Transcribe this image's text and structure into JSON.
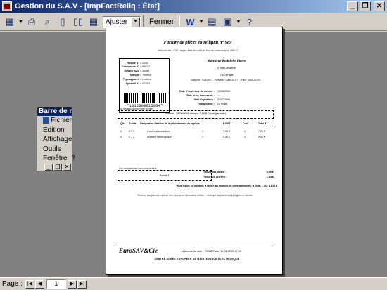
{
  "window": {
    "title": "Gestion du S.A.V - [ImpFactReliq : État]"
  },
  "toolbar": {
    "zoom_value": "Ajuster",
    "close_label": "Fermer"
  },
  "report": {
    "title": "Facture de pièces en reliquat n° 989",
    "subtitle": "Reliquat de la CDE, réglée dans le cadre du bon de commande n° 968/17",
    "info": [
      {
        "k": "Facture N° :",
        "v": "1035"
      },
      {
        "k": "Commande N° :",
        "v": "968/17"
      },
      {
        "k": "Dossier SAV :",
        "v": "36464"
      },
      {
        "k": "Marque :",
        "v": "Thomso"
      },
      {
        "k": "Type appareil :",
        "v": "Lecteur"
      },
      {
        "k": "Appareil N° :",
        "v": "0743/4"
      }
    ],
    "barcode_number": "*1612308025034*",
    "client": {
      "name": "Monsieur Rodolphe Pierre",
      "line1": "4 Rue Lamartine",
      "line2": "75001   Paris",
      "line3": "Domicile : 0142 00 ...     Portable : 0606 12 87 ...     Fax : 0145 23 99 ..."
    },
    "dates": [
      {
        "k": "Date d'ouverture du dossier :",
        "v": "15/05/2006"
      },
      {
        "k": "Date prise commande :",
        "v": "...."
      },
      {
        "k": "Date Expédition :",
        "v": "07/07/2006"
      },
      {
        "k": "Transporteur :",
        "v": "La Poste"
      }
    ],
    "caption_top": "Vos remarques pour notre service :",
    "remark": "Acheté : 28/09/2006 chèque 7,50 € (Vu le garantie)",
    "columns": [
      "Qté",
      "Article",
      "Désignation détaillée de la pièce dentaire de la pièce",
      "P.U.HT",
      "Code",
      "Total HT"
    ],
    "rows": [
      {
        "chk": "X",
        "qte": "2 / 1",
        "article": "2 7 1",
        "designation": "Cordon alimentation",
        "qty": "1",
        "pu": "7,00 €",
        "code": "1",
        "total": "7,00 €"
      },
      {
        "chk": "X",
        "qte": "2 / 1",
        "article": "2 7 2",
        "designation": "Antenne télescopique",
        "qty": "1",
        "pu": "2,40 €",
        "code": "1",
        "total": "2,40 €"
      }
    ],
    "caption_bottom": "Vos commentaires pour notre facture :",
    "comment": "Article 1",
    "totals": [
      {
        "k": "Total Hors taxes :",
        "v": "9,40 €"
      },
      {
        "k": "Total TVA (19,6%) :",
        "v": "1,84 €"
      },
      {
        "k": "Total T.T.C :",
        "v": "11,24 €"
      }
    ],
    "pay_line": "( Vous réglez ce montant, à régler, au moment de votre paiement ) ➜ Total T.T.C :",
    "note": "*Retenue des pièces en attente d'un mois avant l'annulation d'office ... ainsi que les sommes déjà réglées en attente.",
    "logo": "EuroSAV&Cie",
    "address": "4 Avenue du mail ... 75008 Paris     Tél. 01 23 45 67 89",
    "tagline": "CENTRE AGRÉÉ EUROPÉEN DE MAINTENANCE ÉLECTRONIQUE"
  },
  "palette": {
    "title": "Barre de menus",
    "items": [
      "Fichier",
      "Edition",
      "Affichage",
      "Outils",
      "Fenêtre",
      "?"
    ]
  },
  "status": {
    "page_label": "Page :",
    "page_number": "1"
  }
}
